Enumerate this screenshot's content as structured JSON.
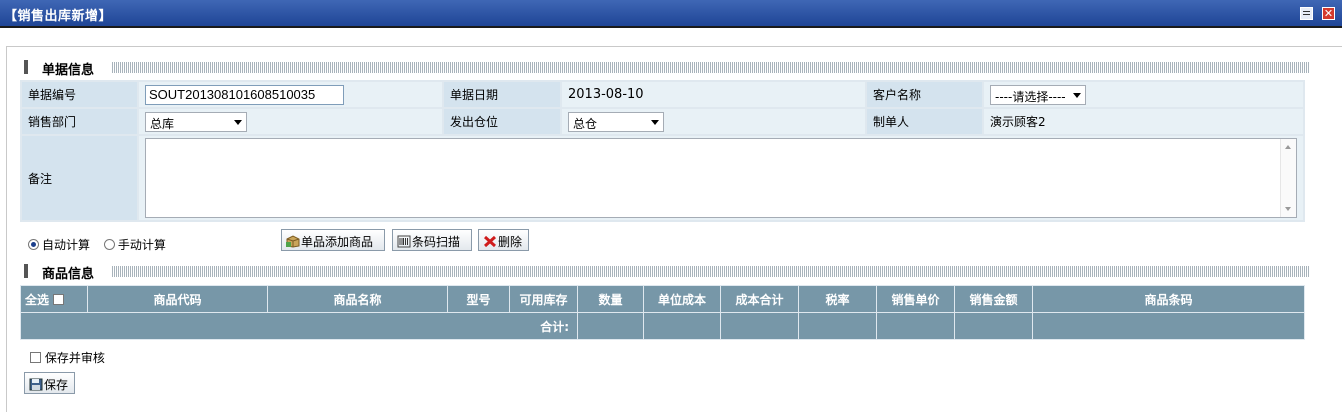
{
  "window": {
    "title": "【销售出库新增】"
  },
  "sections": {
    "doc_info": "单据信息",
    "product_info": "商品信息"
  },
  "form": {
    "doc_no_label": "单据编号",
    "doc_no_value": "SOUT201308101608510035",
    "doc_date_label": "单据日期",
    "doc_date_value": "2013-08-10",
    "customer_label": "客户名称",
    "customer_value": "----请选择----",
    "dept_label": "销售部门",
    "dept_value": "总库",
    "warehouse_label": "发出仓位",
    "warehouse_value": "总仓",
    "creator_label": "制单人",
    "creator_value": "演示顾客2",
    "remark_label": "备注"
  },
  "calc": {
    "auto_label": "自动计算",
    "manual_label": "手动计算",
    "selected": "auto"
  },
  "toolbar": {
    "add_label": "单品添加商品",
    "scan_label": "条码扫描",
    "delete_label": "删除"
  },
  "grid": {
    "select_all": "全选",
    "columns": [
      "商品代码",
      "商品名称",
      "型号",
      "可用库存",
      "数量",
      "单位成本",
      "成本合计",
      "税率",
      "销售单价",
      "销售金额",
      "商品条码"
    ],
    "total_label": "合计:"
  },
  "footer": {
    "save_audit_label": "保存并审核",
    "save_label": "保存"
  },
  "colors": {
    "titlebar": "#2a52a8",
    "grid_header": "#7797a8",
    "label_cell": "#d4e3ee"
  }
}
